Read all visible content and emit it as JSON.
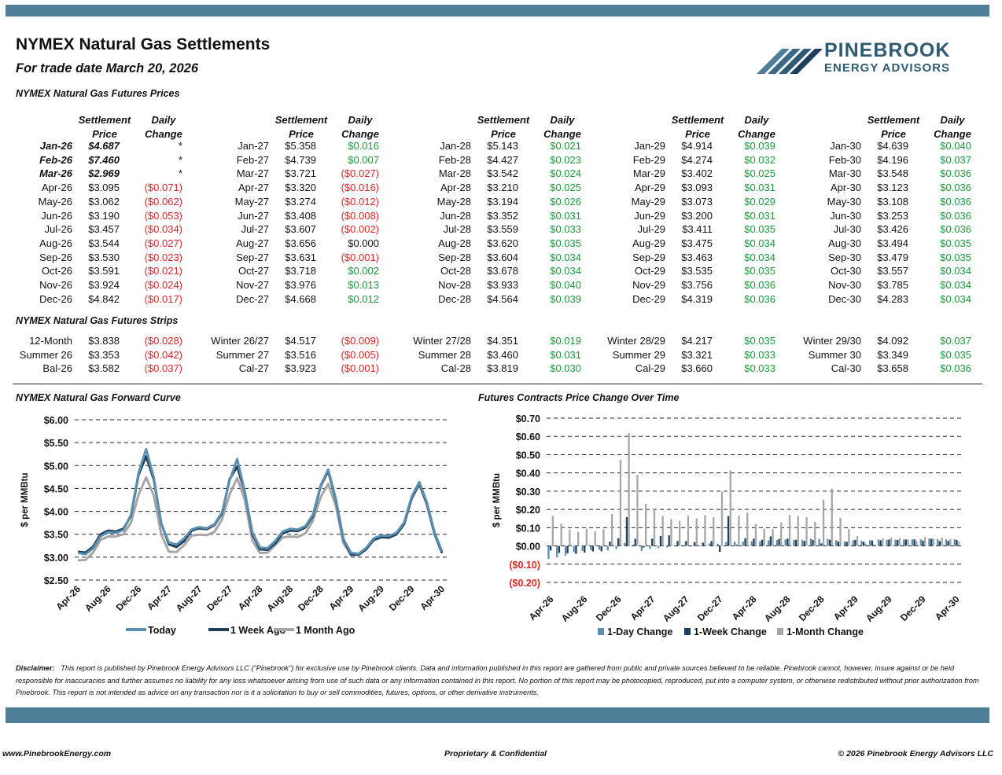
{
  "header": {
    "title": "NYMEX Natural Gas Settlements",
    "subtitle": "For trade date March 20, 2026",
    "logo_line1": "PINEBROOK",
    "logo_line2": "ENERGY ADVISORS"
  },
  "colors": {
    "brand_band": "#4f7f98",
    "today": "#5b8fb0",
    "week_ago": "#1e3f5a",
    "month_ago": "#a6a6a6",
    "negative": "#e02424",
    "positive": "#1a9a3a"
  },
  "prices": {
    "section_label": "NYMEX Natural Gas Futures Prices",
    "col_settlement": [
      "Settlement",
      "Price"
    ],
    "col_change": [
      "Daily",
      "Change"
    ],
    "groups": [
      {
        "rows": [
          [
            "Jan-26",
            "$4.687",
            "*"
          ],
          [
            "Feb-26",
            "$7.460",
            "*"
          ],
          [
            "Mar-26",
            "$2.969",
            "*"
          ],
          [
            "Apr-26",
            "$3.095",
            "($0.071)"
          ],
          [
            "May-26",
            "$3.062",
            "($0.062)"
          ],
          [
            "Jun-26",
            "$3.190",
            "($0.053)"
          ],
          [
            "Jul-26",
            "$3.457",
            "($0.034)"
          ],
          [
            "Aug-26",
            "$3.544",
            "($0.027)"
          ],
          [
            "Sep-26",
            "$3.530",
            "($0.023)"
          ],
          [
            "Oct-26",
            "$3.591",
            "($0.021)"
          ],
          [
            "Nov-26",
            "$3.924",
            "($0.024)"
          ],
          [
            "Dec-26",
            "$4.842",
            "($0.017)"
          ]
        ]
      },
      {
        "rows": [
          [
            "Jan-27",
            "$5.358",
            "$0.016"
          ],
          [
            "Feb-27",
            "$4.739",
            "$0.007"
          ],
          [
            "Mar-27",
            "$3.721",
            "($0.027)"
          ],
          [
            "Apr-27",
            "$3.320",
            "($0.016)"
          ],
          [
            "May-27",
            "$3.274",
            "($0.012)"
          ],
          [
            "Jun-27",
            "$3.408",
            "($0.008)"
          ],
          [
            "Jul-27",
            "$3.607",
            "($0.002)"
          ],
          [
            "Aug-27",
            "$3.656",
            "$0.000"
          ],
          [
            "Sep-27",
            "$3.631",
            "($0.001)"
          ],
          [
            "Oct-27",
            "$3.718",
            "$0.002"
          ],
          [
            "Nov-27",
            "$3.976",
            "$0.013"
          ],
          [
            "Dec-27",
            "$4.668",
            "$0.012"
          ]
        ]
      },
      {
        "rows": [
          [
            "Jan-28",
            "$5.143",
            "$0.021"
          ],
          [
            "Feb-28",
            "$4.427",
            "$0.023"
          ],
          [
            "Mar-28",
            "$3.542",
            "$0.024"
          ],
          [
            "Apr-28",
            "$3.210",
            "$0.025"
          ],
          [
            "May-28",
            "$3.194",
            "$0.026"
          ],
          [
            "Jun-28",
            "$3.352",
            "$0.031"
          ],
          [
            "Jul-28",
            "$3.559",
            "$0.033"
          ],
          [
            "Aug-28",
            "$3.620",
            "$0.035"
          ],
          [
            "Sep-28",
            "$3.604",
            "$0.034"
          ],
          [
            "Oct-28",
            "$3.678",
            "$0.034"
          ],
          [
            "Nov-28",
            "$3.933",
            "$0.040"
          ],
          [
            "Dec-28",
            "$4.564",
            "$0.039"
          ]
        ]
      },
      {
        "rows": [
          [
            "Jan-29",
            "$4.914",
            "$0.039"
          ],
          [
            "Feb-29",
            "$4.274",
            "$0.032"
          ],
          [
            "Mar-29",
            "$3.402",
            "$0.025"
          ],
          [
            "Apr-29",
            "$3.093",
            "$0.031"
          ],
          [
            "May-29",
            "$3.073",
            "$0.029"
          ],
          [
            "Jun-29",
            "$3.200",
            "$0.031"
          ],
          [
            "Jul-29",
            "$3.411",
            "$0.035"
          ],
          [
            "Aug-29",
            "$3.475",
            "$0.034"
          ],
          [
            "Sep-29",
            "$3.463",
            "$0.034"
          ],
          [
            "Oct-29",
            "$3.535",
            "$0.035"
          ],
          [
            "Nov-29",
            "$3.756",
            "$0.036"
          ],
          [
            "Dec-29",
            "$4.319",
            "$0.036"
          ]
        ]
      },
      {
        "rows": [
          [
            "Jan-30",
            "$4.639",
            "$0.040"
          ],
          [
            "Feb-30",
            "$4.196",
            "$0.037"
          ],
          [
            "Mar-30",
            "$3.548",
            "$0.036"
          ],
          [
            "Apr-30",
            "$3.123",
            "$0.036"
          ],
          [
            "May-30",
            "$3.108",
            "$0.036"
          ],
          [
            "Jun-30",
            "$3.253",
            "$0.036"
          ],
          [
            "Jul-30",
            "$3.426",
            "$0.036"
          ],
          [
            "Aug-30",
            "$3.494",
            "$0.035"
          ],
          [
            "Sep-30",
            "$3.479",
            "$0.035"
          ],
          [
            "Oct-30",
            "$3.557",
            "$0.034"
          ],
          [
            "Nov-30",
            "$3.785",
            "$0.034"
          ],
          [
            "Dec-30",
            "$4.283",
            "$0.034"
          ]
        ]
      }
    ]
  },
  "strips": {
    "section_label": "NYMEX Natural Gas Futures Strips",
    "groups": [
      {
        "rows": [
          [
            "12-Month",
            "$3.838",
            "($0.028)"
          ],
          [
            "Summer 26",
            "$3.353",
            "($0.042)"
          ],
          [
            "Bal-26",
            "$3.582",
            "($0.037)"
          ]
        ]
      },
      {
        "rows": [
          [
            "Winter 26/27",
            "$4.517",
            "($0.009)"
          ],
          [
            "Summer 27",
            "$3.516",
            "($0.005)"
          ],
          [
            "Cal-27",
            "$3.923",
            "($0.001)"
          ]
        ]
      },
      {
        "rows": [
          [
            "Winter 27/28",
            "$4.351",
            "$0.019"
          ],
          [
            "Summer 28",
            "$3.460",
            "$0.031"
          ],
          [
            "Cal-28",
            "$3.819",
            "$0.030"
          ]
        ]
      },
      {
        "rows": [
          [
            "Winter 28/29",
            "$4.217",
            "$0.035"
          ],
          [
            "Summer 29",
            "$3.321",
            "$0.033"
          ],
          [
            "Cal-29",
            "$3.660",
            "$0.033"
          ]
        ]
      },
      {
        "rows": [
          [
            "Winter 29/30",
            "$4.092",
            "$0.037"
          ],
          [
            "Summer 30",
            "$3.349",
            "$0.035"
          ],
          [
            "Cal-30",
            "$3.658",
            "$0.036"
          ]
        ]
      }
    ]
  },
  "chart_data": [
    {
      "type": "line",
      "title": "NYMEX Natural Gas Forward Curve",
      "ylabel": "$ per MMBtu",
      "ylim": [
        2.5,
        6.0
      ],
      "yticks": [
        "$2.50",
        "$3.00",
        "$3.50",
        "$4.00",
        "$4.50",
        "$5.00",
        "$5.50",
        "$6.00"
      ],
      "grid": true,
      "legend_position": "bottom",
      "x_tick_labels": [
        "Apr-26",
        "Aug-26",
        "Dec-26",
        "Apr-27",
        "Aug-27",
        "Dec-27",
        "Apr-28",
        "Aug-28",
        "Dec-28",
        "Apr-29",
        "Aug-29",
        "Dec-29",
        "Apr-30"
      ],
      "x_tick_every": 4,
      "series": [
        {
          "name": "Today",
          "values": [
            3.095,
            3.062,
            3.19,
            3.457,
            3.544,
            3.53,
            3.591,
            3.924,
            4.842,
            5.358,
            4.739,
            3.721,
            3.32,
            3.274,
            3.408,
            3.607,
            3.656,
            3.631,
            3.718,
            3.976,
            4.668,
            5.143,
            4.427,
            3.542,
            3.21,
            3.194,
            3.352,
            3.559,
            3.62,
            3.604,
            3.678,
            3.933,
            4.564,
            4.914,
            4.274,
            3.402,
            3.093,
            3.073,
            3.2,
            3.411,
            3.475,
            3.463,
            3.535,
            3.756,
            4.319,
            4.639,
            4.196,
            3.548,
            3.123
          ]
        },
        {
          "name": "1 Week Ago",
          "values": [
            3.12,
            3.1,
            3.23,
            3.5,
            3.58,
            3.56,
            3.62,
            3.9,
            4.8,
            5.2,
            4.7,
            3.73,
            3.28,
            3.22,
            3.35,
            3.58,
            3.63,
            3.61,
            3.7,
            3.95,
            4.7,
            4.98,
            4.42,
            3.5,
            3.17,
            3.16,
            3.3,
            3.52,
            3.58,
            3.57,
            3.65,
            3.9,
            4.55,
            4.88,
            4.25,
            3.38,
            3.06,
            3.05,
            3.17,
            3.38,
            3.44,
            3.43,
            3.5,
            3.72,
            4.29,
            4.6,
            4.17,
            3.52,
            3.09
          ]
        },
        {
          "name": "1 Month Ago",
          "values": [
            2.93,
            2.94,
            3.1,
            3.38,
            3.45,
            3.45,
            3.5,
            3.75,
            4.37,
            4.74,
            4.35,
            3.49,
            3.12,
            3.11,
            3.26,
            3.47,
            3.49,
            3.48,
            3.55,
            3.82,
            4.37,
            4.73,
            4.26,
            3.36,
            3.09,
            3.1,
            3.26,
            3.43,
            3.45,
            3.44,
            3.52,
            3.8,
            4.31,
            4.6,
            4.12,
            3.31,
            3.04,
            3.06,
            3.19,
            3.37,
            3.43,
            3.42,
            3.5,
            3.73,
            4.27,
            4.6,
            4.15,
            3.51,
            3.1
          ]
        }
      ]
    },
    {
      "type": "bar",
      "title": "Futures Contracts Price Change Over Time",
      "ylabel": "$ per MMBtu",
      "ylim": [
        -0.2,
        0.7
      ],
      "yticks": [
        "($0.20)",
        "($0.10)",
        "$0.00",
        "$0.10",
        "$0.20",
        "$0.30",
        "$0.40",
        "$0.50",
        "$0.60",
        "$0.70"
      ],
      "grid": true,
      "legend_position": "bottom",
      "x_tick_labels": [
        "Apr-26",
        "Aug-26",
        "Dec-26",
        "Apr-27",
        "Aug-27",
        "Dec-27",
        "Apr-28",
        "Aug-28",
        "Dec-28",
        "Apr-29",
        "Aug-29",
        "Dec-29",
        "Apr-30"
      ],
      "x_tick_every": 4,
      "series": [
        {
          "name": "1-Day Change",
          "values": [
            -0.071,
            -0.062,
            -0.053,
            -0.034,
            -0.027,
            -0.023,
            -0.021,
            -0.024,
            -0.017,
            0.016,
            0.007,
            -0.027,
            -0.016,
            -0.012,
            -0.008,
            -0.002,
            0.0,
            -0.001,
            0.002,
            0.013,
            0.012,
            0.021,
            0.023,
            0.024,
            0.025,
            0.026,
            0.031,
            0.033,
            0.035,
            0.034,
            0.034,
            0.04,
            0.039,
            0.039,
            0.032,
            0.025,
            0.031,
            0.029,
            0.031,
            0.035,
            0.034,
            0.034,
            0.035,
            0.036,
            0.036,
            0.04,
            0.037,
            0.036,
            0.036
          ]
        },
        {
          "name": "1-Week Change",
          "values": [
            -0.025,
            -0.038,
            -0.04,
            -0.043,
            -0.036,
            -0.03,
            -0.029,
            0.024,
            0.042,
            0.158,
            0.039,
            -0.009,
            0.04,
            0.054,
            0.058,
            0.027,
            0.026,
            0.021,
            0.018,
            0.026,
            -0.032,
            0.163,
            0.007,
            0.042,
            0.04,
            0.034,
            0.052,
            0.039,
            0.04,
            0.034,
            0.028,
            0.033,
            0.014,
            0.034,
            0.024,
            0.022,
            0.033,
            0.023,
            0.03,
            0.031,
            0.035,
            0.033,
            0.035,
            0.036,
            0.029,
            0.039,
            0.026,
            0.028,
            0.033
          ]
        },
        {
          "name": "1-Month Change",
          "values": [
            0.165,
            0.122,
            0.09,
            0.077,
            0.094,
            0.08,
            0.091,
            0.174,
            0.472,
            0.618,
            0.389,
            0.231,
            0.2,
            0.164,
            0.148,
            0.137,
            0.166,
            0.151,
            0.168,
            0.156,
            0.298,
            0.413,
            0.167,
            0.182,
            0.12,
            0.094,
            0.092,
            0.129,
            0.17,
            0.164,
            0.158,
            0.133,
            0.254,
            0.314,
            0.154,
            0.092,
            0.053,
            0.013,
            0.01,
            0.041,
            0.045,
            0.043,
            0.035,
            0.026,
            0.049,
            0.039,
            0.046,
            0.038,
            0.023
          ]
        }
      ]
    }
  ],
  "disclaimer": {
    "label": "Disclaimer:",
    "text": "This report is published by Pinebrook Energy Advisors LLC (\"Pinebrook\") for exclusive use by Pinebrook clients.  Data and information published in this report are gathered from public and private sources believed to be reliable.  Pinebrook cannot, however, insure against or be held responsible for inaccuracies and further assumes no liability for any loss whatsoever arising from use of such data or any information contained in this report.  No portion of this report may be photocopied, reproduced, put into a computer system, or otherwise redistributed without prior authorization from Pinebrook.  This report is not intended as advice on any transaction nor is it a solicitation to buy or sell commodities, futures, options, or other derivative instruments."
  },
  "footer": {
    "website": "www.PinebrookEnergy.com",
    "center": "Proprietary & Confidential",
    "copyright": "© 2026 Pinebrook Energy Advisors LLC"
  }
}
